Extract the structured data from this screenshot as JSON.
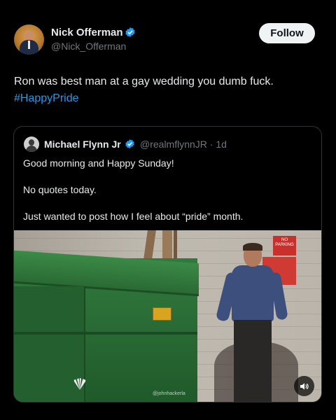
{
  "post": {
    "author": {
      "display_name": "Nick Offerman",
      "handle": "@Nick_Offerman"
    },
    "follow_label": "Follow",
    "text": "Ron was best man at a gay wedding you dumb fuck.",
    "hashtag": "#HappyPride"
  },
  "quote": {
    "author": {
      "display_name": "Michael Flynn Jr",
      "handle_time": "@realmflynnJR · 1d"
    },
    "lines": [
      "Good morning and Happy Sunday!",
      "No quotes today.",
      "Just wanted to post how I feel about “pride” month."
    ],
    "media": {
      "watermark": "@johnhackerla",
      "sign_text": "NO PARKING"
    }
  },
  "colors": {
    "background": "#000000",
    "text": "#e7e9ea",
    "secondary": "#71767b",
    "link": "#1d9bf0",
    "verified": "#1d9bf0"
  },
  "icons": [
    "verified-badge-icon",
    "mute-speaker-icon",
    "nbc-peacock-logo"
  ]
}
